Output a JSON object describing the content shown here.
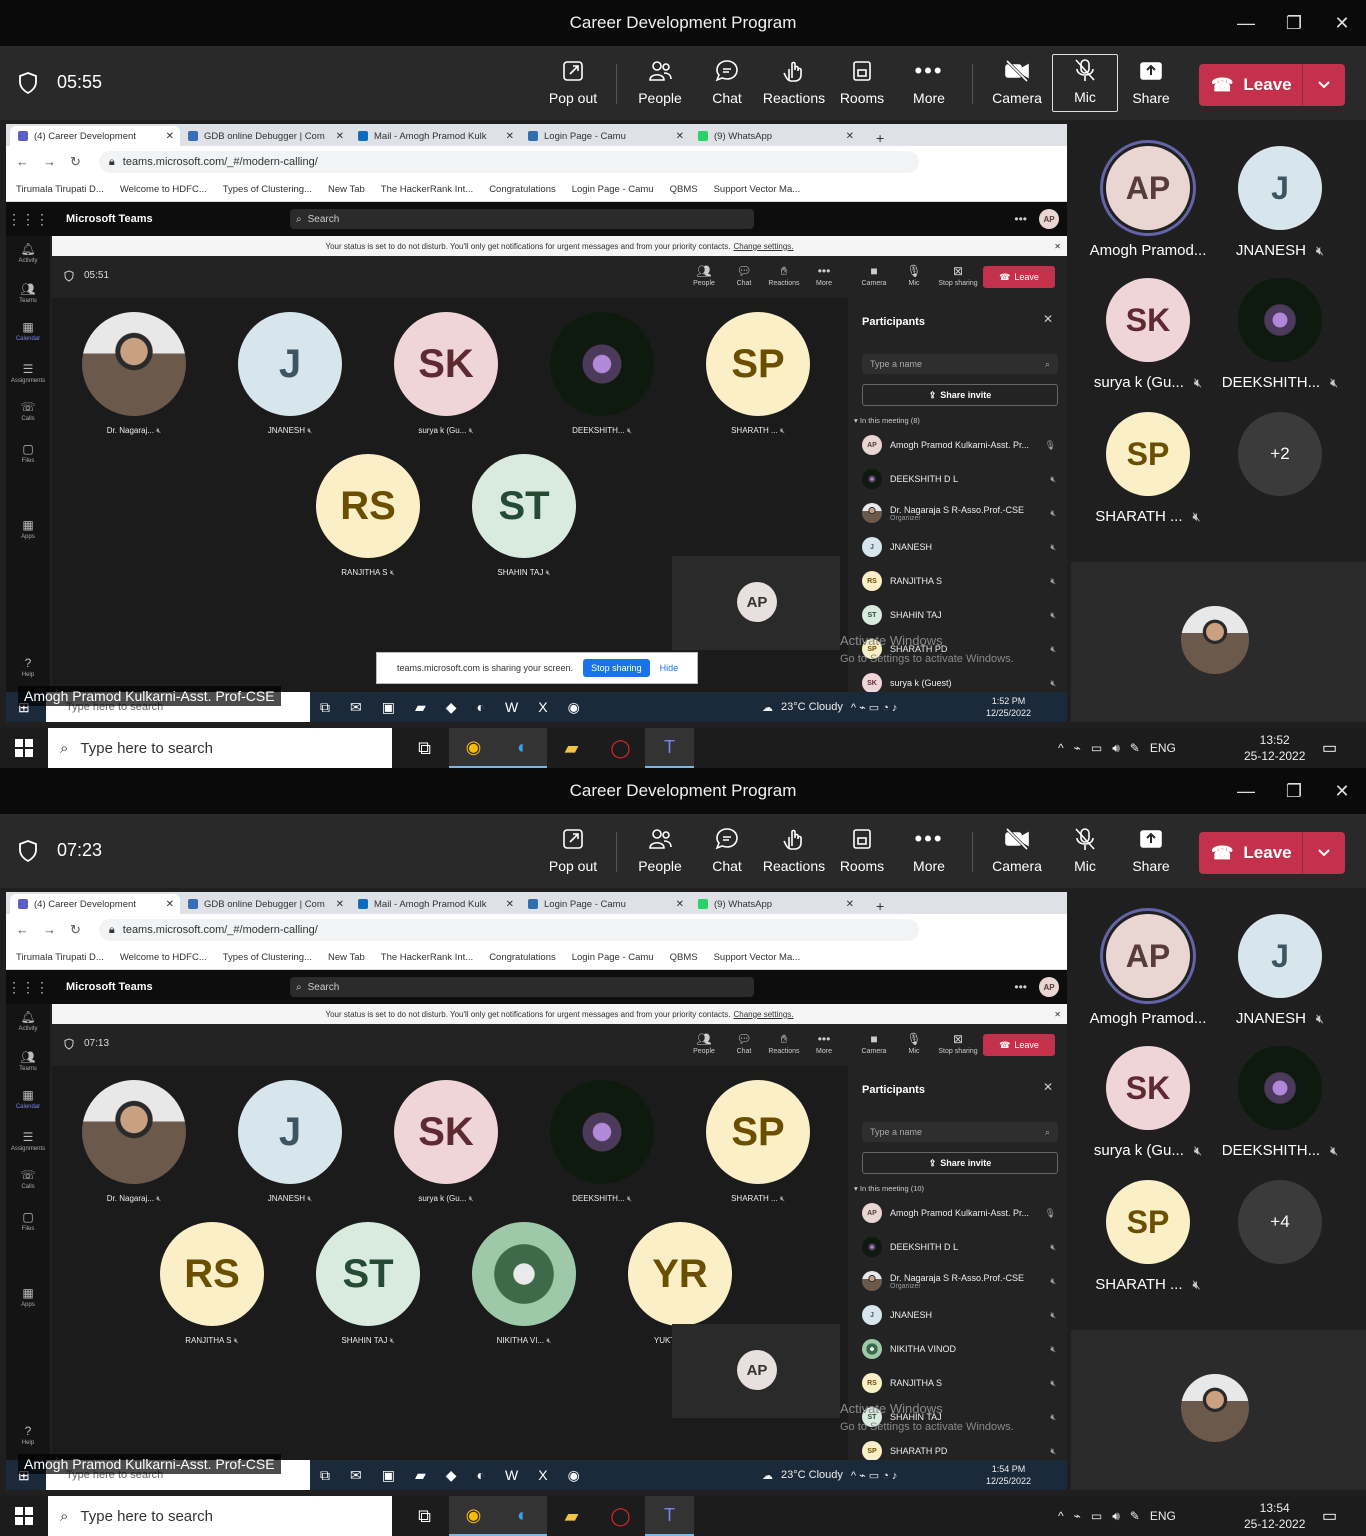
{
  "window": {
    "title": "Career Development Program"
  },
  "toolbar": {
    "pop_out": "Pop out",
    "people": "People",
    "chat": "Chat",
    "reactions": "Reactions",
    "rooms": "Rooms",
    "more": "More",
    "camera": "Camera",
    "mic": "Mic",
    "share": "Share",
    "leave": "Leave"
  },
  "browser": {
    "tabs": [
      "(4) Career Development",
      "GDB online Debugger | Com",
      "Mail - Amogh Pramod Kulk",
      "Login Page - Camu",
      "(9) WhatsApp"
    ],
    "url": "teams.microsoft.com/_#/modern-calling/",
    "bookmarks": [
      "Tirumala Tirupati D...",
      "Welcome to HDFC...",
      "Types of Clustering...",
      "New Tab",
      "The HackerRank Int...",
      "Congratulations",
      "Login Page - Camu",
      "QBMS",
      "Support Vector Ma..."
    ]
  },
  "teams": {
    "brand": "Microsoft Teams",
    "search": "Search",
    "dnd_text": "Your status is set to do not disturb. You'll only get notifications for urgent messages and from your priority contacts.",
    "dnd_link": "Change settings.",
    "rail": [
      "Activity",
      "Teams",
      "Calendar",
      "Assignments",
      "Calls",
      "Files",
      "Apps",
      "Help"
    ],
    "mbar": {
      "people": "People",
      "chat": "Chat",
      "reactions": "Reactions",
      "more": "More",
      "camera": "Camera",
      "mic": "Mic",
      "stop": "Stop sharing",
      "leave": "Leave"
    },
    "panel_title": "Participants",
    "type_name": "Type a name",
    "share_invite": "Share invite",
    "self_initials": "AP",
    "share_bar": {
      "text": "teams.microsoft.com is sharing your screen.",
      "stop": "Stop sharing",
      "hide": "Hide"
    }
  },
  "watermark": {
    "line1": "Activate Windows",
    "line2": "Go to Settings to activate Windows."
  },
  "caption": "Amogh Pramod Kulkarni-Asst. Prof-CSE",
  "inner_taskbar": {
    "search": "Type here to search",
    "weather": "23°C  Cloudy"
  },
  "taskbar": {
    "search": "Type here to search",
    "lang": "ENG"
  },
  "right_tiles": [
    {
      "initials": "AP",
      "name": "Amogh Pramod...",
      "muted": false
    },
    {
      "initials": "J",
      "name": "JNANESH",
      "muted": true
    },
    {
      "initials": "SK",
      "name": "surya k (Gu...",
      "muted": true
    },
    {
      "initials": "",
      "name": "DEEKSHITH...",
      "muted": true
    },
    {
      "initials": "SP",
      "name": "SHARATH ...",
      "muted": true
    }
  ],
  "frames": [
    {
      "timer": "05:55",
      "inner_timer": "05:51",
      "in_meeting": "In this meeting (8)",
      "overflow": "+2",
      "inner_clock": {
        "time": "1:52 PM",
        "date": "12/25/2022"
      },
      "clock": {
        "time": "13:52",
        "date": "25-12-2022"
      },
      "stage": [
        {
          "initials": "",
          "name": "Dr. Nagaraj..."
        },
        {
          "initials": "J",
          "name": "JNANESH"
        },
        {
          "initials": "SK",
          "name": "surya k (Gu..."
        },
        {
          "initials": "",
          "name": "DEEKSHITH..."
        },
        {
          "initials": "SP",
          "name": "SHARATH ..."
        },
        {
          "initials": "RS",
          "name": "RANJITHA S"
        },
        {
          "initials": "ST",
          "name": "SHAHIN TAJ"
        }
      ],
      "participants": [
        {
          "initials": "AP",
          "name": "Amogh Pramod Kulkarni-Asst. Pr...",
          "sub": ""
        },
        {
          "initials": "",
          "name": "DEEKSHITH D L",
          "sub": ""
        },
        {
          "initials": "",
          "name": "Dr. Nagaraja S R-Asso.Prof.-CSE",
          "sub": "Organizer"
        },
        {
          "initials": "J",
          "name": "JNANESH",
          "sub": ""
        },
        {
          "initials": "RS",
          "name": "RANJITHA S",
          "sub": ""
        },
        {
          "initials": "ST",
          "name": "SHAHIN TAJ",
          "sub": ""
        },
        {
          "initials": "SP",
          "name": "SHARATH PD",
          "sub": ""
        },
        {
          "initials": "SK",
          "name": "surya k (Guest)",
          "sub": ""
        }
      ]
    },
    {
      "timer": "07:23",
      "inner_timer": "07:13",
      "in_meeting": "In this meeting (10)",
      "overflow": "+4",
      "inner_clock": {
        "time": "1:54 PM",
        "date": "12/25/2022"
      },
      "clock": {
        "time": "13:54",
        "date": "25-12-2022"
      },
      "stage": [
        {
          "initials": "",
          "name": "Dr. Nagaraj..."
        },
        {
          "initials": "J",
          "name": "JNANESH"
        },
        {
          "initials": "SK",
          "name": "surya k (Gu..."
        },
        {
          "initials": "",
          "name": "DEEKSHITH..."
        },
        {
          "initials": "SP",
          "name": "SHARATH ..."
        },
        {
          "initials": "RS",
          "name": "RANJITHA S"
        },
        {
          "initials": "ST",
          "name": "SHAHIN TAJ"
        },
        {
          "initials": "",
          "name": "NIKITHA VI..."
        },
        {
          "initials": "YR",
          "name": "YUKTHI S R"
        }
      ],
      "participants": [
        {
          "initials": "AP",
          "name": "Amogh Pramod Kulkarni-Asst. Pr...",
          "sub": ""
        },
        {
          "initials": "",
          "name": "DEEKSHITH D L",
          "sub": ""
        },
        {
          "initials": "",
          "name": "Dr. Nagaraja S R-Asso.Prof.-CSE",
          "sub": "Organizer"
        },
        {
          "initials": "J",
          "name": "JNANESH",
          "sub": ""
        },
        {
          "initials": "",
          "name": "NIKITHA VINOD",
          "sub": ""
        },
        {
          "initials": "RS",
          "name": "RANJITHA S",
          "sub": ""
        },
        {
          "initials": "ST",
          "name": "SHAHIN TAJ",
          "sub": ""
        },
        {
          "initials": "SP",
          "name": "SHARATH PD",
          "sub": ""
        }
      ]
    }
  ]
}
